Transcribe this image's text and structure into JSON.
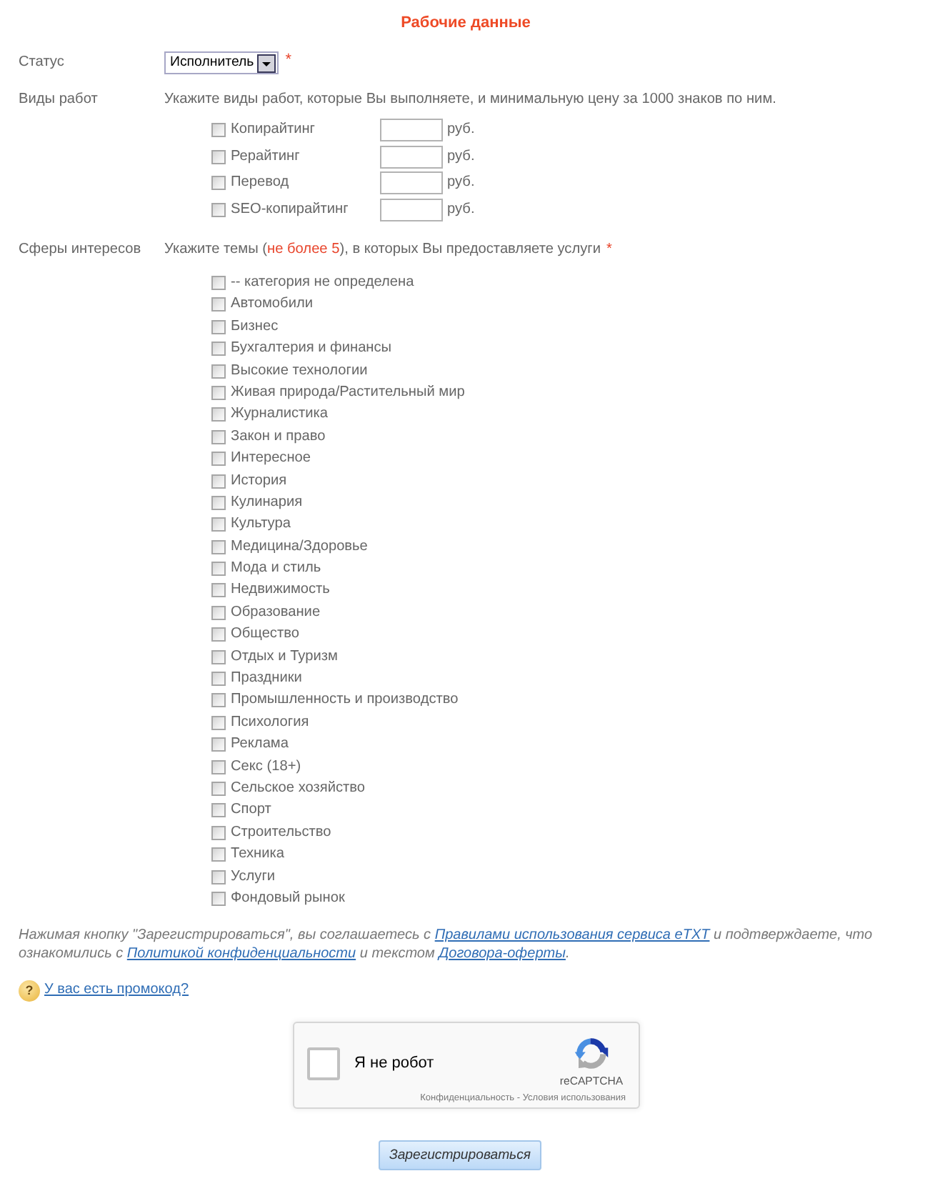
{
  "title": "Рабочие данные",
  "status": {
    "label": "Статус",
    "value": "Исполнитель",
    "required_mark": "*"
  },
  "work_types": {
    "label": "Виды работ",
    "hint": "Укажите виды работ, которые Вы выполняете, и минимальную цену за 1000 знаков по ним.",
    "items": [
      {
        "label": "Копирайтинг",
        "checked": false,
        "unit": "руб."
      },
      {
        "label": "Рерайтинг",
        "checked": false,
        "unit": "руб."
      },
      {
        "label": "Перевод",
        "checked": false,
        "unit": "руб."
      },
      {
        "label": "SEO-копирайтинг",
        "checked": false,
        "unit": "руб."
      }
    ]
  },
  "interests": {
    "label": "Сферы интересов",
    "hint": [
      {
        "kind": "text",
        "text": "Укажите темы ("
      },
      {
        "kind": "highlight",
        "text": "не более 5"
      },
      {
        "kind": "text",
        "text": "), в которых Вы предоставляете услуги"
      }
    ],
    "required_mark": "*",
    "items": [
      {
        "label": "-- категория не определена",
        "checked": false
      },
      {
        "label": "Автомобили",
        "checked": false
      },
      {
        "label": "Бизнес",
        "checked": false
      },
      {
        "label": "Бухгалтерия и финансы",
        "checked": false
      },
      {
        "label": "Высокие технологии",
        "checked": false
      },
      {
        "label": "Живая природа/Растительный мир",
        "checked": false
      },
      {
        "label": "Журналистика",
        "checked": false
      },
      {
        "label": "Закон и право",
        "checked": false
      },
      {
        "label": "Интересное",
        "checked": false
      },
      {
        "label": "История",
        "checked": false
      },
      {
        "label": "Кулинария",
        "checked": false
      },
      {
        "label": "Культура",
        "checked": false
      },
      {
        "label": "Медицина/Здоровье",
        "checked": false
      },
      {
        "label": "Мода и стиль",
        "checked": false
      },
      {
        "label": "Недвижимость",
        "checked": false
      },
      {
        "label": "Образование",
        "checked": false
      },
      {
        "label": "Общество",
        "checked": false
      },
      {
        "label": "Отдых и Туризм",
        "checked": false
      },
      {
        "label": "Праздники",
        "checked": false
      },
      {
        "label": "Промышленность и производство",
        "checked": false
      },
      {
        "label": "Психология",
        "checked": false
      },
      {
        "label": "Реклама",
        "checked": false
      },
      {
        "label": "Секс (18+)",
        "checked": false
      },
      {
        "label": "Сельское хозяйство",
        "checked": false
      },
      {
        "label": "Спорт",
        "checked": false
      },
      {
        "label": "Строительство",
        "checked": false
      },
      {
        "label": "Техника",
        "checked": false
      },
      {
        "label": "Услуги",
        "checked": false
      },
      {
        "label": "Фондовый рынок",
        "checked": false
      }
    ]
  },
  "agreement": [
    {
      "kind": "text",
      "text": "Нажимая кнопку \"Зарегистрироваться\", вы соглашаетесь с "
    },
    {
      "kind": "link",
      "text": "Правилами использования сервиса eTXT"
    },
    {
      "kind": "text",
      "text": " и подтверждаете, что ознакомились с "
    },
    {
      "kind": "link",
      "text": "Политикой конфиденциальности"
    },
    {
      "kind": "text",
      "text": " и текстом "
    },
    {
      "kind": "link",
      "text": "Договора-оферты"
    },
    {
      "kind": "text",
      "text": "."
    }
  ],
  "promo": {
    "icon": "?",
    "link": "У вас есть промокод?"
  },
  "captcha": {
    "checked": false,
    "label": "Я не робот",
    "brand": "reCAPTCHA",
    "footer": "Конфиденциальность - Условия использования"
  },
  "submit": "Зарегистрироваться"
}
